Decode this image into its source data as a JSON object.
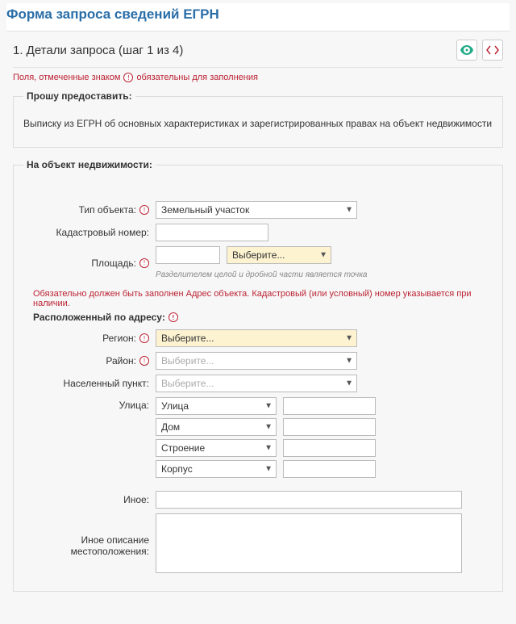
{
  "page_title": "Форма запроса сведений ЕГРН",
  "step": {
    "title": "1. Детали запроса (шаг 1 из 4)"
  },
  "required_note": {
    "prefix": "Поля, отмеченные знаком",
    "suffix": "обязательны для заполнения"
  },
  "section_provide": {
    "legend": "Прошу предоставить:",
    "text": "Выписку из ЕГРН об основных характеристиках и зарегистрированных правах на объект недвижимости"
  },
  "section_object": {
    "legend": "На объект недвижимости:",
    "type_label": "Тип объекта:",
    "type_value": "Земельный участок",
    "cadastral_label": "Кадастровый номер:",
    "cadastral_value": "",
    "area_label": "Площадь:",
    "area_value": "",
    "area_unit": "Выберите...",
    "area_hint": "Разделителем целой и дробной части является точка",
    "warn": "Обязательно должен быть заполнен Адрес объекта. Кадастровый (или условный) номер указывается при наличии.",
    "address_title": "Расположенный по адресу:",
    "region_label": "Регион:",
    "region_value": "Выберите...",
    "district_label": "Район:",
    "district_value": "Выберите...",
    "settlement_label": "Населенный пункт:",
    "settlement_value": "Выберите...",
    "street_label": "Улица:",
    "parts": [
      {
        "type": "Улица",
        "value": ""
      },
      {
        "type": "Дом",
        "value": ""
      },
      {
        "type": "Строение",
        "value": ""
      },
      {
        "type": "Корпус",
        "value": ""
      }
    ],
    "other_label": "Иное:",
    "other_value": "",
    "other_desc_label": "Иное описание местоположения:",
    "other_desc_value": ""
  },
  "req_mark": "!"
}
